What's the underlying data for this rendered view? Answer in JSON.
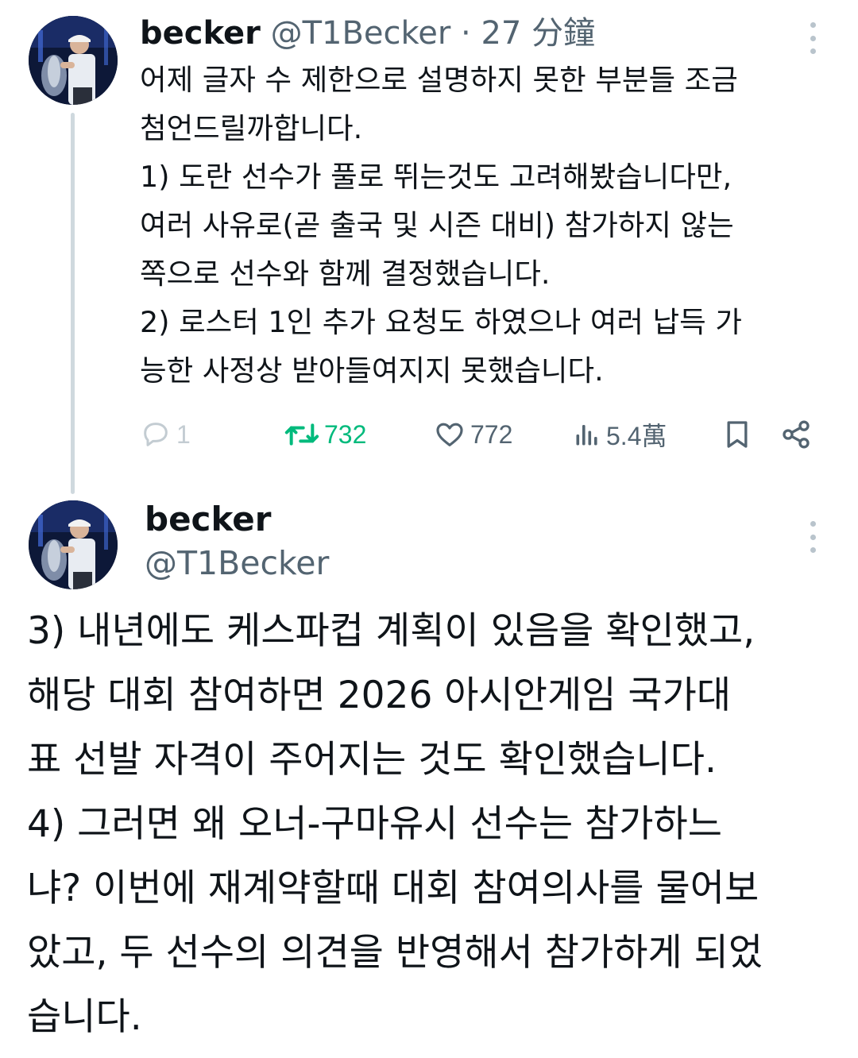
{
  "tweet1": {
    "avatar_icon": "profile-photo-avatar",
    "display_name": "becker",
    "handle": "@T1Becker",
    "separator": "·",
    "time": "27 分鐘",
    "more_icon": "more-vertical-icon",
    "lines": [
      "어제 글자 수 제한으로 설명하지 못한 부분들 조금",
      "첨언드릴까합니다.",
      "1) 도란 선수가 풀로 뛰는것도 고려해봤습니다만,",
      "여러 사유로(곧 출국 및 시즌 대비) 참가하지 않는",
      "쪽으로 선수와 함께 결정했습니다.",
      "2) 로스터 1인 추가 요청도 하였으나 여러 납득 가",
      "능한 사정상 받아들여지지 못했습니다."
    ],
    "actions": {
      "reply_count": "1",
      "retweet_count": "732",
      "like_count": "772",
      "view_count": "5.4萬"
    },
    "action_colors": {
      "retweet": "#00ba7c",
      "default": "#536471"
    }
  },
  "tweet2": {
    "avatar_icon": "profile-photo-avatar",
    "display_name": "becker",
    "handle": "@T1Becker",
    "more_icon": "more-vertical-icon",
    "lines": [
      "3) 내년에도 케스파컵 계획이 있음을 확인했고,",
      "해당 대회 참여하면 2026 아시안게임 국가대",
      "표 선발 자격이 주어지는 것도 확인했습니다.",
      "4) 그러면 왜 오너-구마유시 선수는 참가하느",
      "냐? 이번에 재계약할때 대회 참여의사를 물어보",
      "았고, 두 선수의 의견을 반영해서 참가하게 되었",
      "습니다."
    ]
  }
}
